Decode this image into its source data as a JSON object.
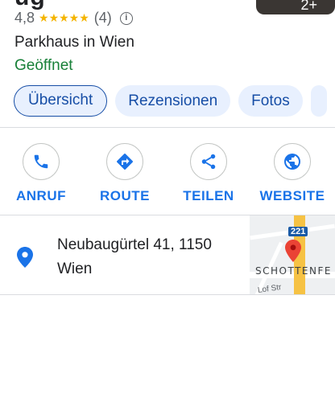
{
  "header": {
    "title_partial": "ug",
    "photo_count": "2+"
  },
  "rating": {
    "score": "4,8",
    "stars": "★★★★★",
    "count": "(4)",
    "info_symbol": "i"
  },
  "place": {
    "category": "Parkhaus in Wien",
    "status": "Geöffnet"
  },
  "tabs": [
    {
      "label": "Übersicht",
      "active": true
    },
    {
      "label": "Rezensionen",
      "active": false
    },
    {
      "label": "Fotos",
      "active": false
    }
  ],
  "actions": [
    {
      "label": "ANRUF",
      "icon": "phone-icon"
    },
    {
      "label": "ROUTE",
      "icon": "directions-icon"
    },
    {
      "label": "TEILEN",
      "icon": "share-icon"
    },
    {
      "label": "WEBSITE",
      "icon": "globe-icon"
    }
  ],
  "address": {
    "line1": "Neubaugürtel 41, 1150",
    "line2": "Wien",
    "icon": "location-pin-icon"
  },
  "map": {
    "route_shield": "221",
    "district_label": "SCHOTTENFE",
    "street_label": "Lof Str"
  },
  "colors": {
    "accent": "#1a73e8",
    "open_status": "#188038",
    "star": "#f4b400",
    "chip_bg": "#e8f0fe",
    "chip_text": "#174ea6",
    "pin_red": "#ea4335"
  }
}
